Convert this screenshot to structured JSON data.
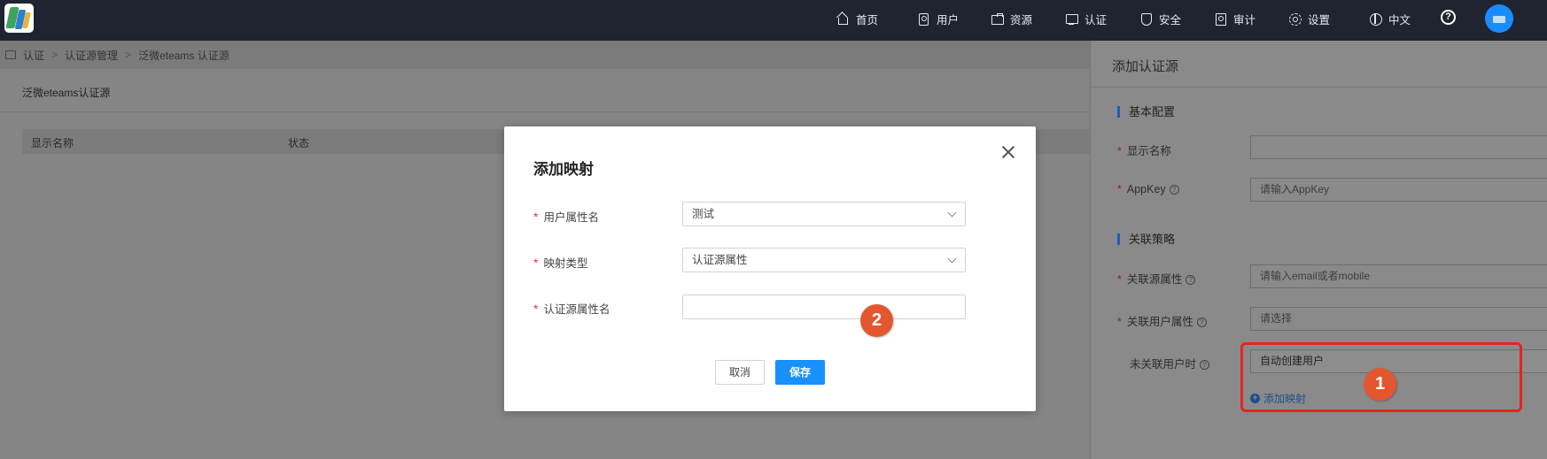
{
  "nav": {
    "items": [
      {
        "label": "首页",
        "icon": "home-icon"
      },
      {
        "label": "用户",
        "icon": "user-icon"
      },
      {
        "label": "资源",
        "icon": "resource-icon"
      },
      {
        "label": "认证",
        "icon": "auth-icon"
      },
      {
        "label": "安全",
        "icon": "shield-icon"
      },
      {
        "label": "审计",
        "icon": "audit-icon"
      },
      {
        "label": "设置",
        "icon": "gear-icon"
      },
      {
        "label": "中文",
        "icon": "language-icon"
      }
    ],
    "help": "?"
  },
  "breadcrumb": [
    "认证",
    "认证源管理",
    "泛微eteams 认证源"
  ],
  "card": {
    "title": "泛微eteams认证源",
    "columns": [
      "显示名称",
      "状态"
    ]
  },
  "drawer": {
    "title": "添加认证源",
    "sections": {
      "basic": "基本配置",
      "link": "关联策略"
    },
    "fields": {
      "display_name": {
        "label": "显示名称",
        "value": ""
      },
      "appkey": {
        "label": "AppKey",
        "placeholder": "请输入AppKey"
      },
      "link_source_attr": {
        "label": "关联源属性",
        "placeholder": "请输入email或者mobile"
      },
      "link_user_attr": {
        "label": "关联用户属性",
        "placeholder": "请选择"
      },
      "unlinked_user": {
        "label": "未关联用户时",
        "value": "自动创建用户"
      }
    },
    "add_mapping": "添加映射"
  },
  "modal": {
    "title": "添加映射",
    "fields": {
      "user_attr": {
        "label": "用户属性名",
        "value": "测试"
      },
      "mapping_type": {
        "label": "映射类型",
        "value": "认证源属性"
      },
      "source_attr": {
        "label": "认证源属性名",
        "value": ""
      }
    },
    "cancel": "取消",
    "save": "保存"
  },
  "annotations": {
    "badge1": "1",
    "badge2": "2",
    "highlight_color": "#e8231f",
    "badge_color": "#e4572e"
  },
  "colors": {
    "topbar": "#1f2430",
    "primary": "#1890ff",
    "required": "#e0363b"
  }
}
